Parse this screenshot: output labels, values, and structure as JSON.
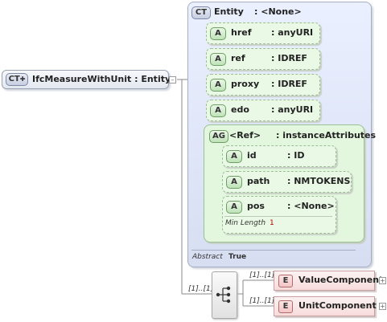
{
  "root": {
    "badge": "CT",
    "label": "IfcMeasureWithUnit : Entity"
  },
  "entity": {
    "badge": "CT",
    "name": "Entity",
    "type": ": <None>",
    "attributes": [
      {
        "badge": "A",
        "name": "href",
        "type": ": anyURI"
      },
      {
        "badge": "A",
        "name": "ref",
        "type": ": IDREF"
      },
      {
        "badge": "A",
        "name": "proxy",
        "type": ": IDREF"
      },
      {
        "badge": "A",
        "name": "edo",
        "type": ": anyURI"
      }
    ],
    "group": {
      "badge": "AG",
      "name": "<Ref>",
      "type": ": instanceAttributes",
      "attributes": [
        {
          "badge": "A",
          "name": "id",
          "type": ": ID"
        },
        {
          "badge": "A",
          "name": "path",
          "type": ": NMTOKENS"
        },
        {
          "badge": "A",
          "name": "pos",
          "type": ": <None>",
          "facet_label": "Min Length",
          "facet_value": "1"
        }
      ]
    },
    "abstract_label": "Abstract",
    "abstract_value": "True"
  },
  "choice_occurrence": "[1]..[1]",
  "elements": [
    {
      "badge": "E",
      "name": "ValueComponent",
      "occurrence": "[1]..[1]"
    },
    {
      "badge": "E",
      "name": "UnitComponent",
      "occurrence": "[1]..[1]"
    }
  ],
  "colors": {
    "panel": "#d7def2",
    "attribute": "#e9f9e5",
    "element": "#f8dcdc",
    "facet_value": "#c00000"
  },
  "icons": {
    "collapse": "minus-box-icon",
    "expand": "plus-box-icon",
    "choice": "choice-compositor-icon"
  }
}
